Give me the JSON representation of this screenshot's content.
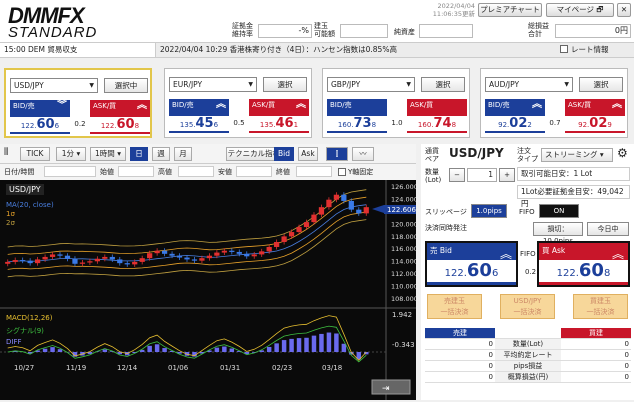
{
  "header": {
    "logo_main": "DMM",
    "logo_fx": "FX",
    "logo_sub": "STANDARD",
    "margin_rate_label": "証拠金\n維持率",
    "margin_rate_value": "-%",
    "available_label": "建玉\n可能額",
    "available_value": "",
    "net_assets_label": "純資産",
    "net_assets_value": "",
    "date": "2022/04/04",
    "time": "11:06:35更新",
    "premium_chart": "プレミアチャート",
    "mypage": "マイページ",
    "total_pl_label": "総損益\n合計",
    "total_pl_value": "0円",
    "close": "✕"
  },
  "news": {
    "left": "15:00 DEM 貿易収支",
    "text": "2022/04/04 10:29 香港株寄り付き（4日）：ハンセン指数は0.85%高",
    "rate_info": "レート情報"
  },
  "panels": [
    {
      "pair": "USD/JPY",
      "btn": "選択中",
      "bid_label": "BID/売",
      "ask_label": "ASK/買",
      "bid_pre": "122.",
      "bid_big": "60",
      "bid_small": "6",
      "ask_pre": "122.",
      "ask_big": "60",
      "ask_small": "8",
      "spread": "0.2"
    },
    {
      "pair": "EUR/JPY",
      "btn": "選択",
      "bid_label": "BID/売",
      "ask_label": "ASK/買",
      "bid_pre": "135.",
      "bid_big": "45",
      "bid_small": "6",
      "ask_pre": "135.",
      "ask_big": "46",
      "ask_small": "1",
      "spread": "0.5"
    },
    {
      "pair": "GBP/JPY",
      "btn": "選択",
      "bid_label": "BID/売",
      "ask_label": "ASK/買",
      "bid_pre": "160.",
      "bid_big": "73",
      "bid_small": "8",
      "ask_pre": "160.",
      "ask_big": "74",
      "ask_small": "8",
      "spread": "1.0"
    },
    {
      "pair": "AUD/JPY",
      "btn": "選択",
      "bid_label": "BID/売",
      "ask_label": "ASK/買",
      "bid_pre": "92.",
      "bid_big": "02",
      "bid_small": "2",
      "ask_pre": "92.",
      "ask_big": "02",
      "ask_small": "9",
      "spread": "0.7"
    }
  ],
  "chart_toolbar": {
    "tick": "TICK",
    "min": "1分",
    "hour": "1時間",
    "day": "日",
    "week": "週",
    "month": "月",
    "tech": "テクニカル指標",
    "bid": "Bid",
    "ask": "Ask"
  },
  "ohlc": {
    "datetime": "日付/時間",
    "open": "始値",
    "high": "高値",
    "low": "安値",
    "close": "終値",
    "yfix": "Y軸固定"
  },
  "chart": {
    "pair": "USD/JPY",
    "ma": "MA(20, close)",
    "s1": "1σ",
    "s2": "2σ",
    "macd": "MACD(12,26)",
    "signal": "シグナル(9)",
    "diff": "DIFF",
    "current": "122.606",
    "y_ticks": [
      "126.000",
      "124.000",
      "122.000",
      "120.000",
      "118.000",
      "116.000",
      "114.000",
      "112.000",
      "110.000",
      "108.000"
    ],
    "macd_ticks": [
      "1.942",
      "-0.343"
    ],
    "x_ticks": [
      "10/27",
      "11/19",
      "12/14",
      "01/06",
      "01/31",
      "02/23",
      "03/18"
    ]
  },
  "chart_data": {
    "type": "candlestick",
    "x_ticks": [
      "10/27",
      "11/19",
      "12/14",
      "01/06",
      "01/31",
      "02/23",
      "03/18"
    ],
    "ylim": [
      108,
      126
    ],
    "current": 122.606,
    "close_approx": [
      113.8,
      114.1,
      114.0,
      113.6,
      114.2,
      114.6,
      115.0,
      114.8,
      114.3,
      113.5,
      113.7,
      113.9,
      114.3,
      114.6,
      114.2,
      113.6,
      113.4,
      113.8,
      114.4,
      115.2,
      115.6,
      115.1,
      114.8,
      114.5,
      114.2,
      114.0,
      114.4,
      114.8,
      115.3,
      115.6,
      115.4,
      115.1,
      114.7,
      115.0,
      115.5,
      116.2,
      117.0,
      117.9,
      118.6,
      119.4,
      120.2,
      121.4,
      122.6,
      123.8,
      124.6,
      123.6,
      122.2,
      121.6,
      122.6
    ]
  },
  "order": {
    "pair_label": "通貨\nペア",
    "pair": "USD/JPY",
    "type_label": "注文\nタイプ",
    "type": "ストリーミング",
    "qty_label": "数量\n(Lot)",
    "qty_minus": "−",
    "qty": "1",
    "qty_plus": "+",
    "unit_info": "取引可能日安：1 Lot",
    "margin_info": "1Lot必要証拠金目安：49,042円",
    "slip_label": "スリッページ",
    "slip_value": "1.0pips",
    "fifo_label": "FIFO",
    "fifo_value": "ON",
    "settle_label": "決済同時発注",
    "settle_btn": "損切：10.0pips",
    "today_btn": "今日中",
    "bid_label": "売 Bid",
    "ask_label": "買 Ask",
    "fifo_mid": "FIFO",
    "spread": "0.2",
    "bid_pre": "122.",
    "bid_big": "60",
    "bid_small": "6",
    "ask_pre": "122.",
    "ask_big": "60",
    "ask_small": "8",
    "btn_sell_close": "売建玉\n一括決済",
    "btn_pair_close": "USD/JPY\n一括決済",
    "btn_buy_close": "買建玉\n一括決済",
    "sell_head": "売建",
    "buy_head": "買建",
    "rows": [
      {
        "label": "数量(Lot)",
        "sell": "0",
        "buy": "0"
      },
      {
        "label": "平均約定レート",
        "sell": "0",
        "buy": "0"
      },
      {
        "label": "pips損益",
        "sell": "0",
        "buy": "0"
      },
      {
        "label": "概算損益(円)",
        "sell": "0",
        "buy": "0"
      }
    ]
  },
  "colors": {
    "bid": "#1c3f9a",
    "ask": "#c8162a",
    "active": "#e2c64a"
  }
}
